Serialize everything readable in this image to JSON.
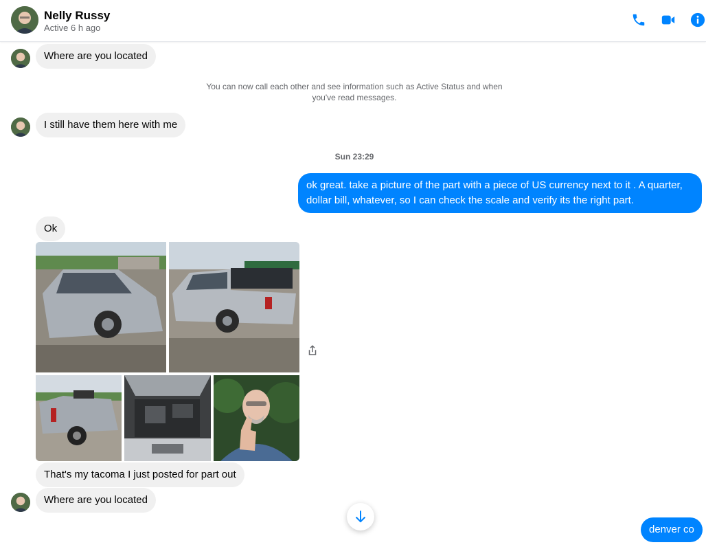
{
  "header": {
    "name": "Nelly Russy",
    "status": "Active 6 h ago",
    "accent_color": "#0084ff",
    "icons": [
      "phone-icon",
      "video-camera-icon",
      "info-icon"
    ]
  },
  "messages": {
    "m1": "Where are you located",
    "system": "You can now call each other and see information such as Active Status and when you've read messages.",
    "m2": "I still have them here with me",
    "timestamp": "Sun 23:29",
    "out1": "ok great. take a picture of the part with a piece of US currency next to it . A quarter, dollar bill, whatever, so I can check the scale and verify its the right part.",
    "m3": "Ok",
    "m4": "That's my tacoma I just posted for part out",
    "m5": "Where are you located",
    "out2": "denver co"
  },
  "photos": [
    "damaged-truck-front-photo",
    "truck-side-photo",
    "truck-rear-photo",
    "engine-bay-photo",
    "man-thumbs-up-photo"
  ],
  "colors": {
    "incoming_bubble": "#f0f0f0",
    "outgoing_bubble": "#0084ff",
    "muted_text": "#65676b"
  }
}
